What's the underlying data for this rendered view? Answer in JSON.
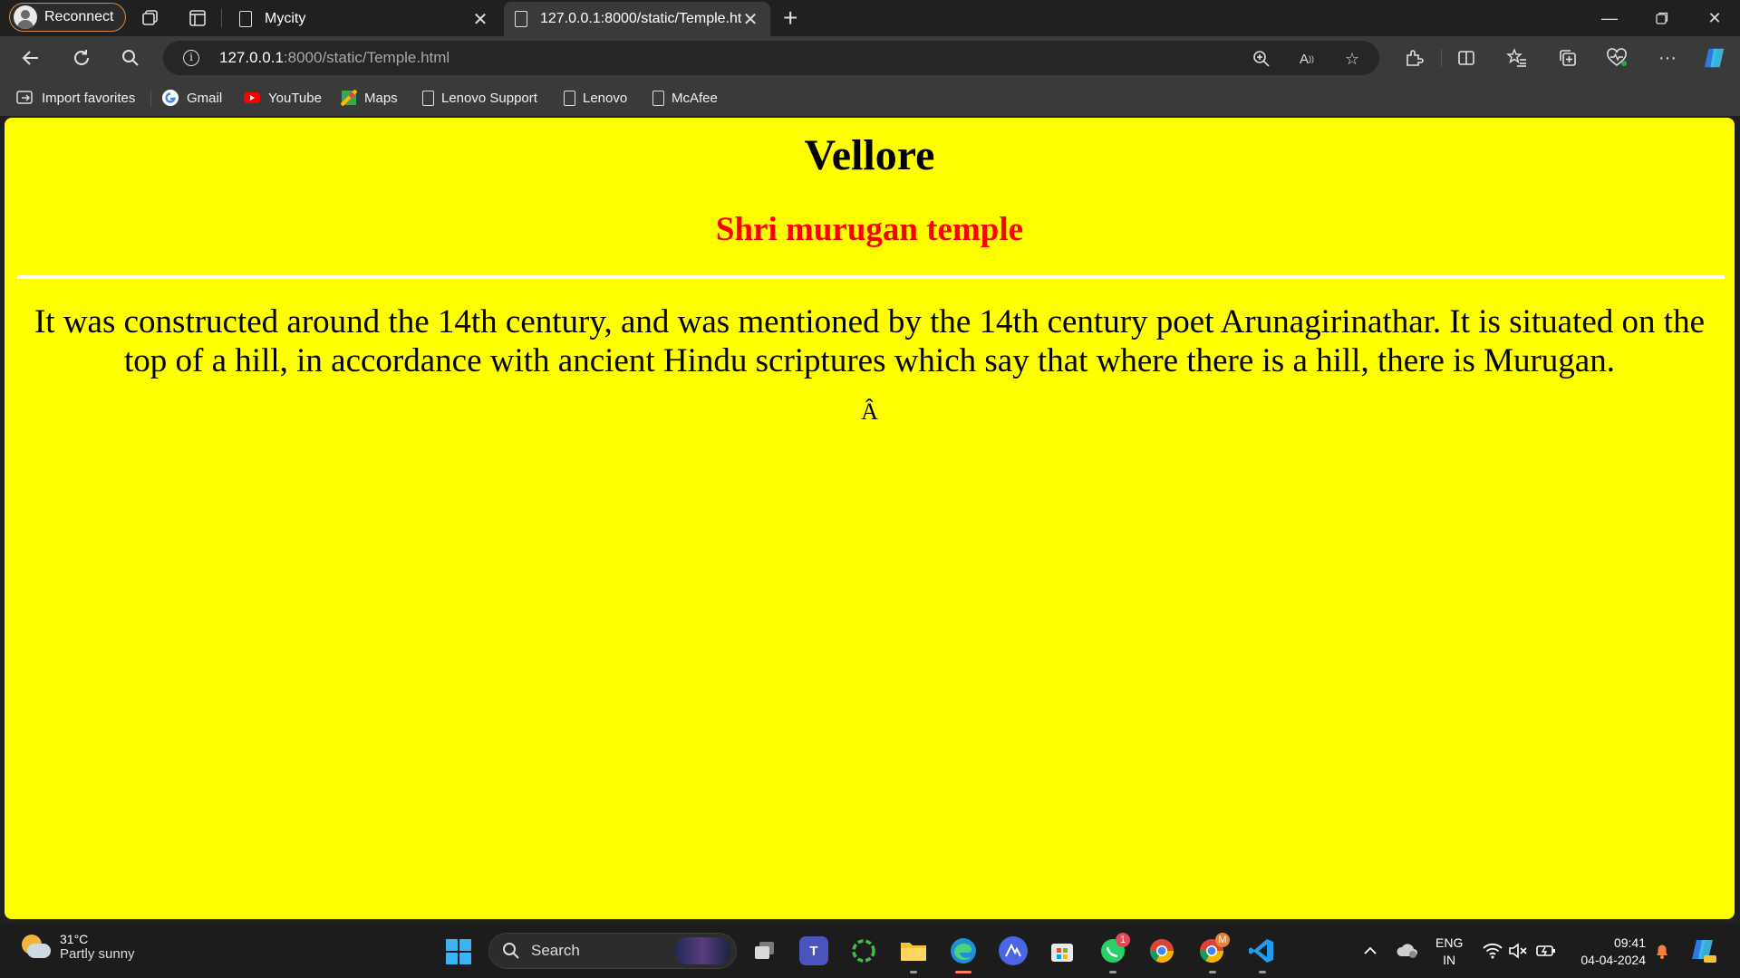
{
  "browser": {
    "profile_label": "Reconnect",
    "tabs": [
      {
        "title": "Mycity",
        "active": false
      },
      {
        "title": "127.0.0.1:8000/static/Temple.html",
        "active": true
      }
    ],
    "address": {
      "host": "127.0.0.1",
      "path": ":8000/static/Temple.html"
    },
    "bookmarks": [
      {
        "label": "Import favorites",
        "icon": "import-icon"
      },
      {
        "label": "Gmail",
        "icon": "google-icon"
      },
      {
        "label": "YouTube",
        "icon": "youtube-icon"
      },
      {
        "label": "Maps",
        "icon": "maps-icon"
      },
      {
        "label": "Lenovo Support",
        "icon": "page-icon"
      },
      {
        "label": "Lenovo",
        "icon": "page-icon"
      },
      {
        "label": "McAfee",
        "icon": "page-icon"
      }
    ]
  },
  "page": {
    "background": "#ffff00",
    "heading": "Vellore",
    "subheading": "Shri murugan temple",
    "subheading_color": "#ff0000",
    "description": "It was constructed around the 14th century, and was mentioned by the 14th century poet Arunagirinathar. It is situated on the top of a hill, in accordance with ancient Hindu scriptures which say that where there is a hill, there is Murugan.",
    "stray_char": "Â"
  },
  "taskbar": {
    "weather_temp": "31°C",
    "weather_desc": "Partly sunny",
    "search_label": "Search",
    "whatsapp_badge": "1",
    "chrome_profile_badge": "M",
    "lang_line1": "ENG",
    "lang_line2": "IN",
    "time": "09:41",
    "date": "04-04-2024"
  }
}
